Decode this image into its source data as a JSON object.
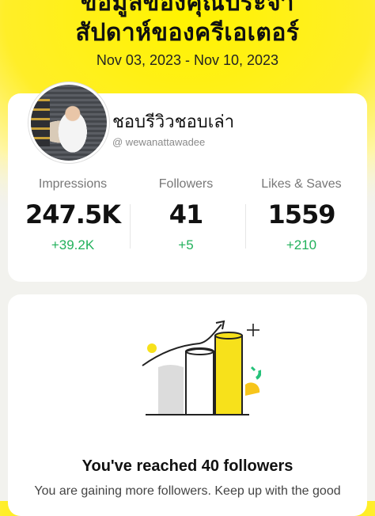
{
  "header": {
    "title_line1": "ข้อมูลของคุณประจำ",
    "title_line2": "สัปดาห์ของครีเอเตอร์",
    "date_range": "Nov 03, 2023 - Nov 10, 2023"
  },
  "profile": {
    "display_name": "ชอบรีวิวชอบเล่า",
    "username": "@ wewanattawadee"
  },
  "stats": [
    {
      "label": "Impressions",
      "value": "247.5K",
      "delta": "+39.2K"
    },
    {
      "label": "Followers",
      "value": "41",
      "delta": "+5"
    },
    {
      "label": "Likes & Saves",
      "value": "1559",
      "delta": "+210"
    }
  ],
  "milestone": {
    "title": "You've reached 40 followers",
    "body": "You are gaining more followers. Keep up with the good"
  },
  "colors": {
    "brand_yellow": "#ffee28",
    "positive_green": "#22b15b"
  }
}
